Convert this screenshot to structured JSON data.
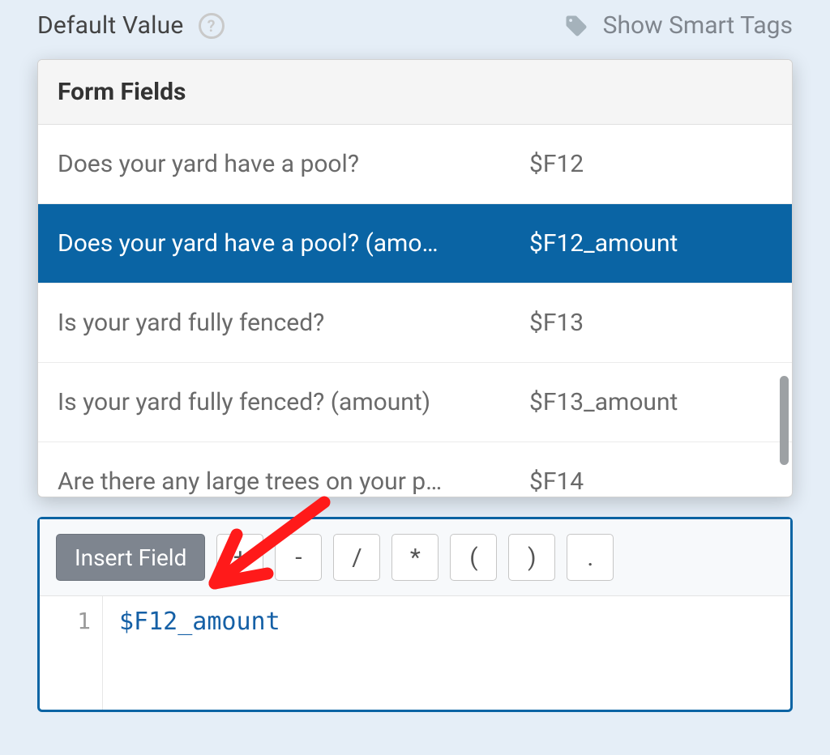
{
  "header": {
    "title": "Default Value",
    "help_tooltip": "?",
    "smart_tags_label": "Show Smart Tags"
  },
  "dropdown": {
    "title": "Form Fields",
    "items": [
      {
        "label": "Does your yard have a pool?",
        "token": "$F12",
        "selected": false
      },
      {
        "label": "Does your yard have a pool? (amo…",
        "token": "$F12_amount",
        "selected": true
      },
      {
        "label": "Is your yard fully fenced?",
        "token": "$F13",
        "selected": false
      },
      {
        "label": "Is your yard fully fenced? (amount)",
        "token": "$F13_amount",
        "selected": false
      },
      {
        "label": "Are there any large trees on your p…",
        "token": "$F14",
        "selected": false
      }
    ]
  },
  "toolbar": {
    "insert_label": "Insert Field",
    "ops": [
      "+",
      "-",
      "/",
      "*",
      "(",
      ")",
      "."
    ]
  },
  "editor": {
    "lines": [
      {
        "num": "1",
        "text": "$F12_amount"
      }
    ]
  }
}
